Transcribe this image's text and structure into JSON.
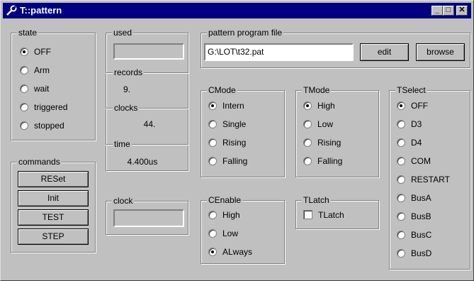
{
  "window": {
    "title": "T::pattern",
    "minimize": "_",
    "maximize": "□",
    "close": "✕"
  },
  "state": {
    "label": "state",
    "options": [
      {
        "label": "OFF",
        "selected": true
      },
      {
        "label": "Arm",
        "selected": false
      },
      {
        "label": "wait",
        "selected": false
      },
      {
        "label": "triggered",
        "selected": false
      },
      {
        "label": "stopped",
        "selected": false
      }
    ]
  },
  "used": {
    "label": "used",
    "value": ""
  },
  "records": {
    "label": "records",
    "value": "9."
  },
  "clocks": {
    "label": "clocks",
    "value": "44."
  },
  "time": {
    "label": "time",
    "value": "4.400us"
  },
  "commands": {
    "label": "commands",
    "buttons": [
      "RESet",
      "Init",
      "TEST",
      "STEP"
    ]
  },
  "clock": {
    "label": "clock",
    "value": ""
  },
  "pattern_file": {
    "label": "pattern program file",
    "value": "G:\\LOT\\t32.pat",
    "edit": "edit",
    "browse": "browse"
  },
  "cmode": {
    "label": "CMode",
    "options": [
      {
        "label": "Intern",
        "selected": true
      },
      {
        "label": "Single",
        "selected": false
      },
      {
        "label": "Rising",
        "selected": false
      },
      {
        "label": "Falling",
        "selected": false
      }
    ]
  },
  "tmode": {
    "label": "TMode",
    "options": [
      {
        "label": "High",
        "selected": true
      },
      {
        "label": "Low",
        "selected": false
      },
      {
        "label": "Rising",
        "selected": false
      },
      {
        "label": "Falling",
        "selected": false
      }
    ]
  },
  "tselect": {
    "label": "TSelect",
    "options": [
      {
        "label": "OFF",
        "selected": true
      },
      {
        "label": "D3",
        "selected": false
      },
      {
        "label": "D4",
        "selected": false
      },
      {
        "label": "COM",
        "selected": false
      },
      {
        "label": "RESTART",
        "selected": false
      },
      {
        "label": "BusA",
        "selected": false
      },
      {
        "label": "BusB",
        "selected": false
      },
      {
        "label": "BusC",
        "selected": false
      },
      {
        "label": "BusD",
        "selected": false
      }
    ]
  },
  "cenable": {
    "label": "CEnable",
    "options": [
      {
        "label": "High",
        "selected": false
      },
      {
        "label": "Low",
        "selected": false
      },
      {
        "label": "ALways",
        "selected": true
      }
    ]
  },
  "tlatch": {
    "label": "TLatch",
    "checkbox_label": "TLatch",
    "checked": false
  }
}
